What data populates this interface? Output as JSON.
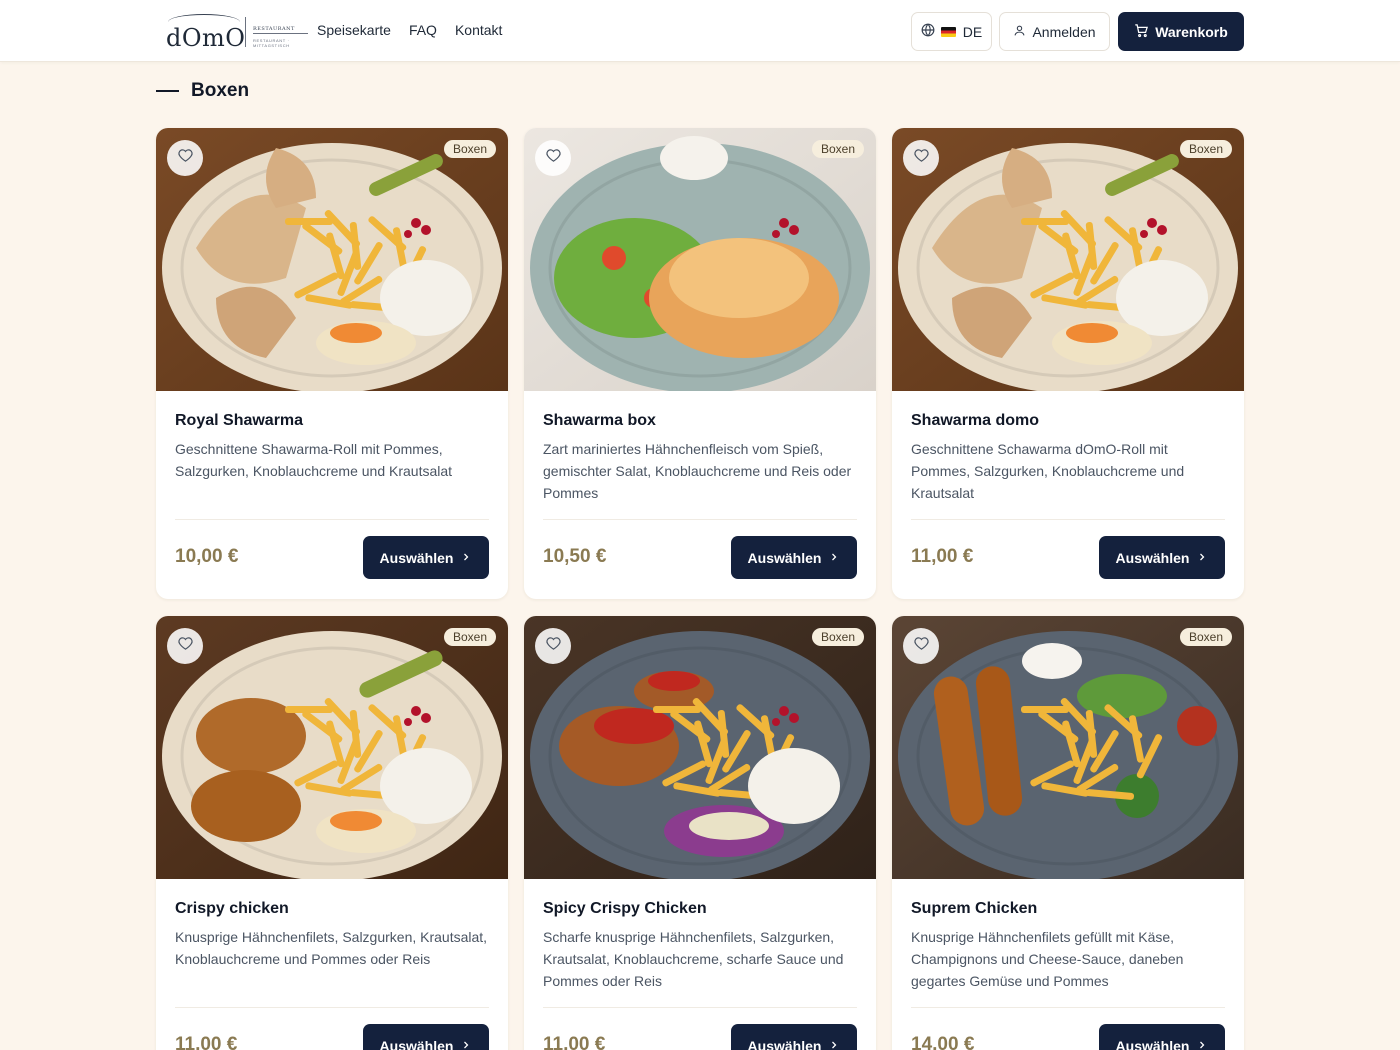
{
  "header": {
    "logo_word": "dOmO",
    "logo_sub": "RESTAURANT",
    "logo_sub2": "RESTAURANT · MITTAGSTISCH",
    "nav": [
      {
        "label": "Speisekarte"
      },
      {
        "label": "FAQ"
      },
      {
        "label": "Kontakt"
      }
    ],
    "language_label": "DE",
    "login_label": "Anmelden",
    "cart_label": "Warenkorb"
  },
  "section": {
    "title": "Boxen"
  },
  "products": [
    {
      "name": "Royal Shawarma",
      "description": "Geschnittene Shawarma-Roll mit Pommes, Salzgurken, Knoblauchcreme und Krautsalat",
      "price": "10,00 €",
      "badge": "Boxen",
      "button_label": "Auswählen",
      "image": "shawarma-plate"
    },
    {
      "name": "Shawarma box",
      "description": "Zart mariniertes Hähnchenfleisch vom Spieß, gemischter Salat, Knoblauchcreme und Reis oder Pommes",
      "price": "10,50 €",
      "badge": "Boxen",
      "button_label": "Auswählen",
      "image": "chicken-salad-plate"
    },
    {
      "name": "Shawarma domo",
      "description": "Geschnittene Schawarma dOmO-Roll mit Pommes, Salzgurken, Knoblauchcreme und Krautsalat",
      "price": "11,00 €",
      "badge": "Boxen",
      "button_label": "Auswählen",
      "image": "shawarma-plate"
    },
    {
      "name": "Crispy chicken",
      "description": "Knusprige Hähnchenfilets, Salzgurken, Krautsalat, Knoblauchcreme und Pommes oder Reis",
      "price": "11,00 €",
      "badge": "Boxen",
      "button_label": "Auswählen",
      "image": "crispy-chicken-plate"
    },
    {
      "name": "Spicy Crispy Chicken",
      "description": "Scharfe knusprige Hähnchenfilets, Salzgurken, Krautsalat, Knoblauchcreme, scharfe Sauce und Pommes oder Reis",
      "price": "11,00 €",
      "badge": "Boxen",
      "button_label": "Auswählen",
      "image": "spicy-chicken-plate"
    },
    {
      "name": "Suprem Chicken",
      "description": "Knusprige Hähnchenfilets gefüllt mit Käse, Champignons und Cheese-Sauce, daneben gegartes Gemüse und Pommes",
      "price": "14,00 €",
      "badge": "Boxen",
      "button_label": "Auswählen",
      "image": "suprem-chicken-plate"
    }
  ]
}
